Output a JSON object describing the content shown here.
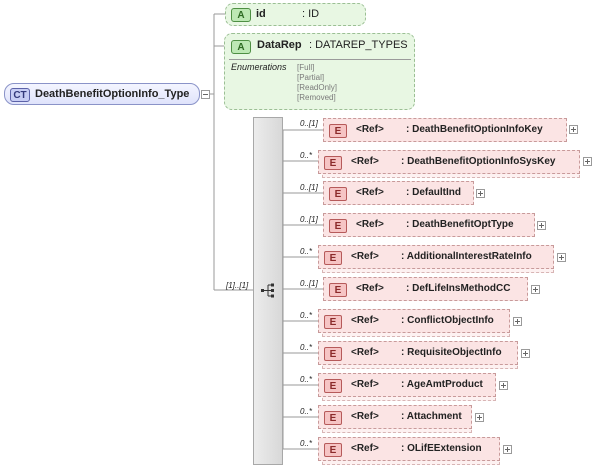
{
  "complex_type": {
    "badge": "CT",
    "name": "DeathBenefitOptionInfo_Type"
  },
  "attributes": [
    {
      "badge": "A",
      "name": "id",
      "type": ": ID"
    },
    {
      "badge": "A",
      "name": "DataRep",
      "type": ": DATAREP_TYPES",
      "enumerations_title": "Enumerations",
      "enumerations": [
        "[Full]",
        "[Partial]",
        "[ReadOnly]",
        "[Removed]"
      ]
    }
  ],
  "sequence": {
    "cardinality": "[1]..[1]"
  },
  "elements": [
    {
      "badge": "E",
      "ref": "<Ref>",
      "name": ": DeathBenefitOptionInfoKey",
      "cardinality": "0..[1]"
    },
    {
      "badge": "E",
      "ref": "<Ref>",
      "name": ": DeathBenefitOptionInfoSysKey",
      "cardinality": "0..*"
    },
    {
      "badge": "E",
      "ref": "<Ref>",
      "name": ": DefaultInd",
      "cardinality": "0..[1]"
    },
    {
      "badge": "E",
      "ref": "<Ref>",
      "name": ": DeathBenefitOptType",
      "cardinality": "0..[1]"
    },
    {
      "badge": "E",
      "ref": "<Ref>",
      "name": ": AdditionalInterestRateInfo",
      "cardinality": "0..*"
    },
    {
      "badge": "E",
      "ref": "<Ref>",
      "name": ": DefLifeInsMethodCC",
      "cardinality": "0..[1]"
    },
    {
      "badge": "E",
      "ref": "<Ref>",
      "name": ": ConflictObjectInfo",
      "cardinality": "0..*"
    },
    {
      "badge": "E",
      "ref": "<Ref>",
      "name": ": RequisiteObjectInfo",
      "cardinality": "0..*"
    },
    {
      "badge": "E",
      "ref": "<Ref>",
      "name": ": AgeAmtProduct",
      "cardinality": "0..*"
    },
    {
      "badge": "E",
      "ref": "<Ref>",
      "name": ": Attachment",
      "cardinality": "0..*"
    },
    {
      "badge": "E",
      "ref": "<Ref>",
      "name": ": OLifEExtension",
      "cardinality": "0..*"
    }
  ],
  "colors": {
    "complex_type": "#dfe3fb",
    "attribute": "#e8f7e3",
    "element": "#fbe4e4",
    "sequence": "#d8d8d8"
  }
}
